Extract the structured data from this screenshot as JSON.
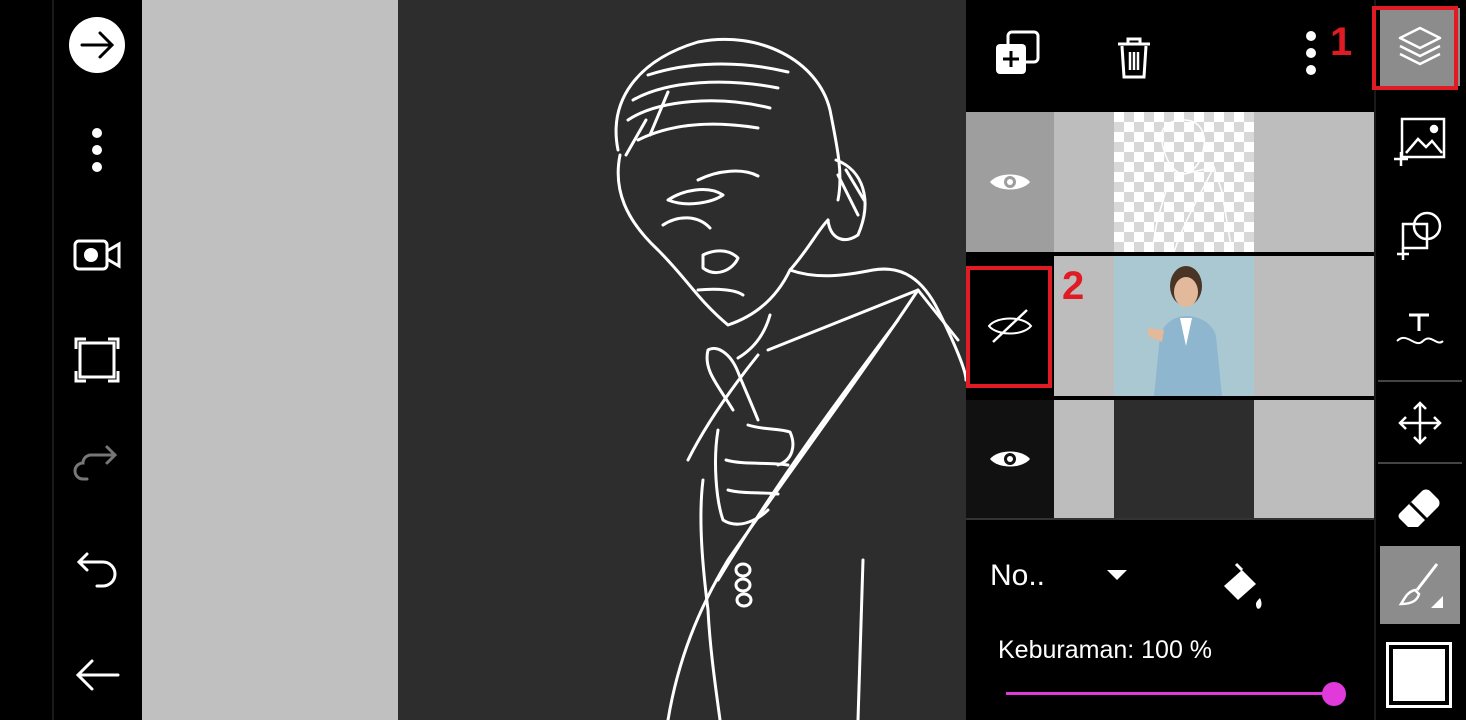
{
  "left_toolbar": {
    "buttons": [
      {
        "name": "forward-arrow-icon"
      },
      {
        "name": "more-options-icon"
      },
      {
        "name": "video-camera-icon"
      },
      {
        "name": "fullscreen-icon"
      },
      {
        "name": "redo-icon"
      },
      {
        "name": "undo-icon"
      },
      {
        "name": "back-arrow-icon"
      }
    ]
  },
  "layers_panel": {
    "header_icons": [
      "add-layer-icon",
      "trash-icon",
      "more-vertical-icon"
    ],
    "layers": [
      {
        "visibility": "visible",
        "thumbnail": "line-art-sketch",
        "selected": true
      },
      {
        "visibility": "hidden",
        "thumbnail": "woman-photo",
        "selected": false
      },
      {
        "visibility": "visible",
        "thumbnail": "empty-dark",
        "selected": false
      }
    ],
    "blend_mode": "No..",
    "opacity_label": "Keburaman: 100 %",
    "opacity_value": 100,
    "slider_color": "#e03adb"
  },
  "right_toolbar": {
    "tools": [
      "layers-icon",
      "add-image-icon",
      "shapes-icon",
      "text-icon",
      "move-icon",
      "eraser-icon",
      "brush-icon",
      "color-swatch"
    ]
  },
  "annotations": {
    "label_1": "1",
    "label_2": "2",
    "color": "#e01b24"
  }
}
